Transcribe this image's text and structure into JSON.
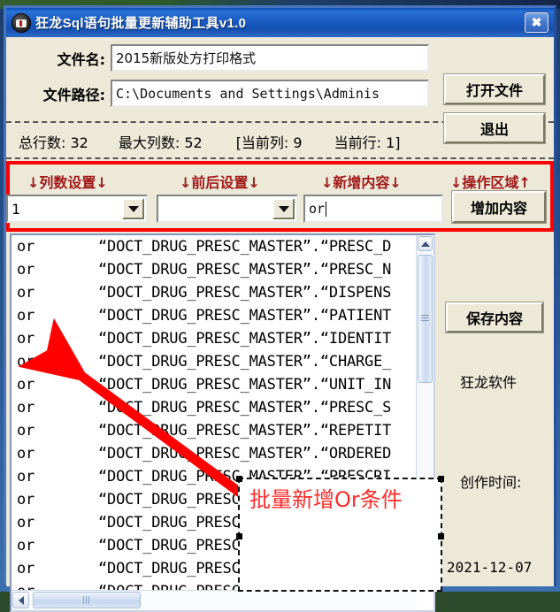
{
  "window": {
    "title": "狂龙Sql语句批量更新辅助工具v1.0",
    "icon": "app-logo-icon",
    "close_label": "✖"
  },
  "form": {
    "file_name_label": "文件名:",
    "file_name_value": "2015新版处方打印格式",
    "file_path_label": "文件路径:",
    "file_path_value": "C:\\Documents and Settings\\Adminis",
    "open_file_label": "打开文件",
    "exit_label": "退出"
  },
  "stats": {
    "total_rows": "总行数: 32",
    "max_columns": "最大列数: 52",
    "current_column": "[当前列: 9",
    "current_row": "当前行: 1]"
  },
  "controls": {
    "label_column": "↓列数设置↓",
    "label_position": "↓前后设置↓",
    "label_new_content": "↓新增内容↓",
    "label_action_area": "↓操作区域↑",
    "column_value": "1",
    "position_value": "",
    "new_content_value": "or",
    "add_content_label": "增加内容",
    "highlight_color": "#ff0000",
    "label_color": "#a01818"
  },
  "list": {
    "prefix": "or",
    "rows": [
      "“DOCT_DRUG_PRESC_MASTER”.“PRESC_D",
      "“DOCT_DRUG_PRESC_MASTER”.“PRESC_N",
      "“DOCT_DRUG_PRESC_MASTER”.“DISPENS",
      "“DOCT_DRUG_PRESC_MASTER”.“PATIENT",
      "“DOCT_DRUG_PRESC_MASTER”.“IDENTIT",
      "“DOCT_DRUG_PRESC_MASTER”.“CHARGE_",
      "“DOCT_DRUG_PRESC_MASTER”.“UNIT_IN",
      "“DOCT_DRUG_PRESC_MASTER”.“PRESC_S",
      "“DOCT_DRUG_PRESC_MASTER”.“REPETIT",
      "“DOCT_DRUG_PRESC_MASTER”.“ORDERED",
      "“DOCT_DRUG_PRESC_MASTER”.“PRESCRI",
      "“DOCT_DRUG_PRESC_DETAIL”.“LTEM_NO",
      "“DOCT_DRUG_PRESC",
      "“DOCT_DRUG_PRESC",
      "“DOCT_DRUG_PRESC",
      "“DOCT_DRUG_PRESC"
    ]
  },
  "side": {
    "save_content_label": "保存内容",
    "brand": "狂龙软件",
    "created_label": "创作时间:",
    "created_date": "2021-12-07"
  },
  "annotation": {
    "text": "批量新增Or条件",
    "color": "#ff2b2b"
  }
}
